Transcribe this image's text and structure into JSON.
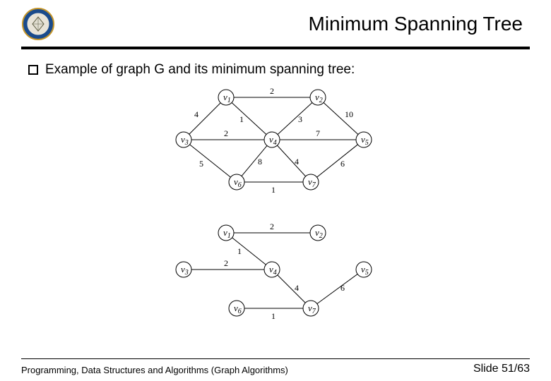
{
  "header": {
    "title": "Minimum Spanning Tree"
  },
  "body": {
    "bullet": "Example of graph G and its minimum spanning tree:"
  },
  "graph_top": {
    "nodes": {
      "v1": "v",
      "v1s": "1",
      "v2": "v",
      "v2s": "2",
      "v3": "v",
      "v3s": "3",
      "v4": "v",
      "v4s": "4",
      "v5": "v",
      "v5s": "5",
      "v6": "v",
      "v6s": "6",
      "v7": "v",
      "v7s": "7"
    },
    "weights": {
      "e12": "2",
      "e13": "4",
      "e14": "1",
      "e24": "3",
      "e25": "10",
      "e34": "2",
      "e45": "7",
      "e36": "5",
      "e46": "8",
      "e47": "4",
      "e57": "6",
      "e67": "1"
    }
  },
  "graph_bottom": {
    "nodes": {
      "v1": "v",
      "v1s": "1",
      "v2": "v",
      "v2s": "2",
      "v3": "v",
      "v3s": "3",
      "v4": "v",
      "v4s": "4",
      "v5": "v",
      "v5s": "5",
      "v6": "v",
      "v6s": "6",
      "v7": "v",
      "v7s": "7"
    },
    "weights": {
      "e12": "2",
      "e14": "1",
      "e34": "2",
      "e47": "4",
      "e57": "6",
      "e67": "1"
    }
  },
  "footer": {
    "left": "Programming, Data Structures and Algorithms  (Graph Algorithms)",
    "right": "Slide 51/63"
  }
}
